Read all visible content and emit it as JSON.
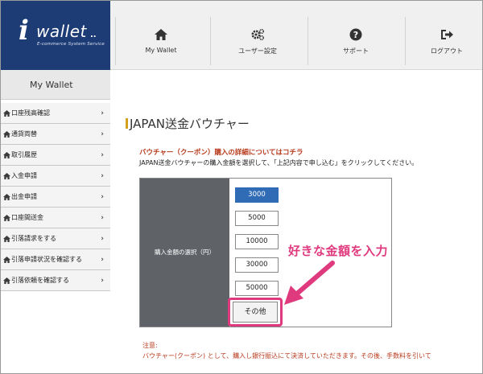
{
  "logo": {
    "mark": "i",
    "name": "wallet",
    "dots": "..",
    "tagline": "E-commerce System Service"
  },
  "nav": [
    {
      "label": "My Wallet",
      "icon": "home-icon"
    },
    {
      "label": "ユーザー設定",
      "icon": "gears-icon"
    },
    {
      "label": "サポート",
      "icon": "question-circle-icon"
    },
    {
      "label": "ログアウト",
      "icon": "sign-out-icon"
    }
  ],
  "sidebar": {
    "heading": "My Wallet",
    "items": [
      {
        "label": "口座残高確認",
        "icon": "home-icon"
      },
      {
        "label": "通貨両替",
        "icon": "home-icon"
      },
      {
        "label": "取引履歴",
        "icon": "home-icon"
      },
      {
        "label": "入金申請",
        "icon": "home-icon"
      },
      {
        "label": "出金申請",
        "icon": "home-icon"
      },
      {
        "label": "口座間送金",
        "icon": "home-icon"
      },
      {
        "label": "引落請求をする",
        "icon": "home-icon"
      },
      {
        "label": "引落申請状況を確認する",
        "icon": "home-icon"
      },
      {
        "label": "引落依頼を確認する",
        "icon": "home-icon"
      }
    ],
    "chevron": "›"
  },
  "main": {
    "title": "JAPAN送金バウチャー",
    "detail_link": "バウチャー（クーポン）購入の詳細についてはコチラ",
    "instruction": "JAPAN送金バウチャーの購入金額を選択して、「上記内容で申し込む」をクリックしてください。",
    "form": {
      "label": "購入金額の選択（円）",
      "amounts": [
        "3000",
        "5000",
        "10000",
        "30000",
        "50000"
      ],
      "selected": "3000",
      "other": "その他"
    },
    "callout": "好きな金額を入力",
    "note_label": "注意:",
    "note_text": "バウチャー(クーポン) として、購入し銀行振込にて決済していただきます。その後、手数料を引いて"
  },
  "colors": {
    "brand_navy": "#1d3b74",
    "selected_blue": "#2f6cb5",
    "highlight_pink": "#e03a7e",
    "link_red": "#b83a1c",
    "accent_gold": "#d4a020"
  }
}
